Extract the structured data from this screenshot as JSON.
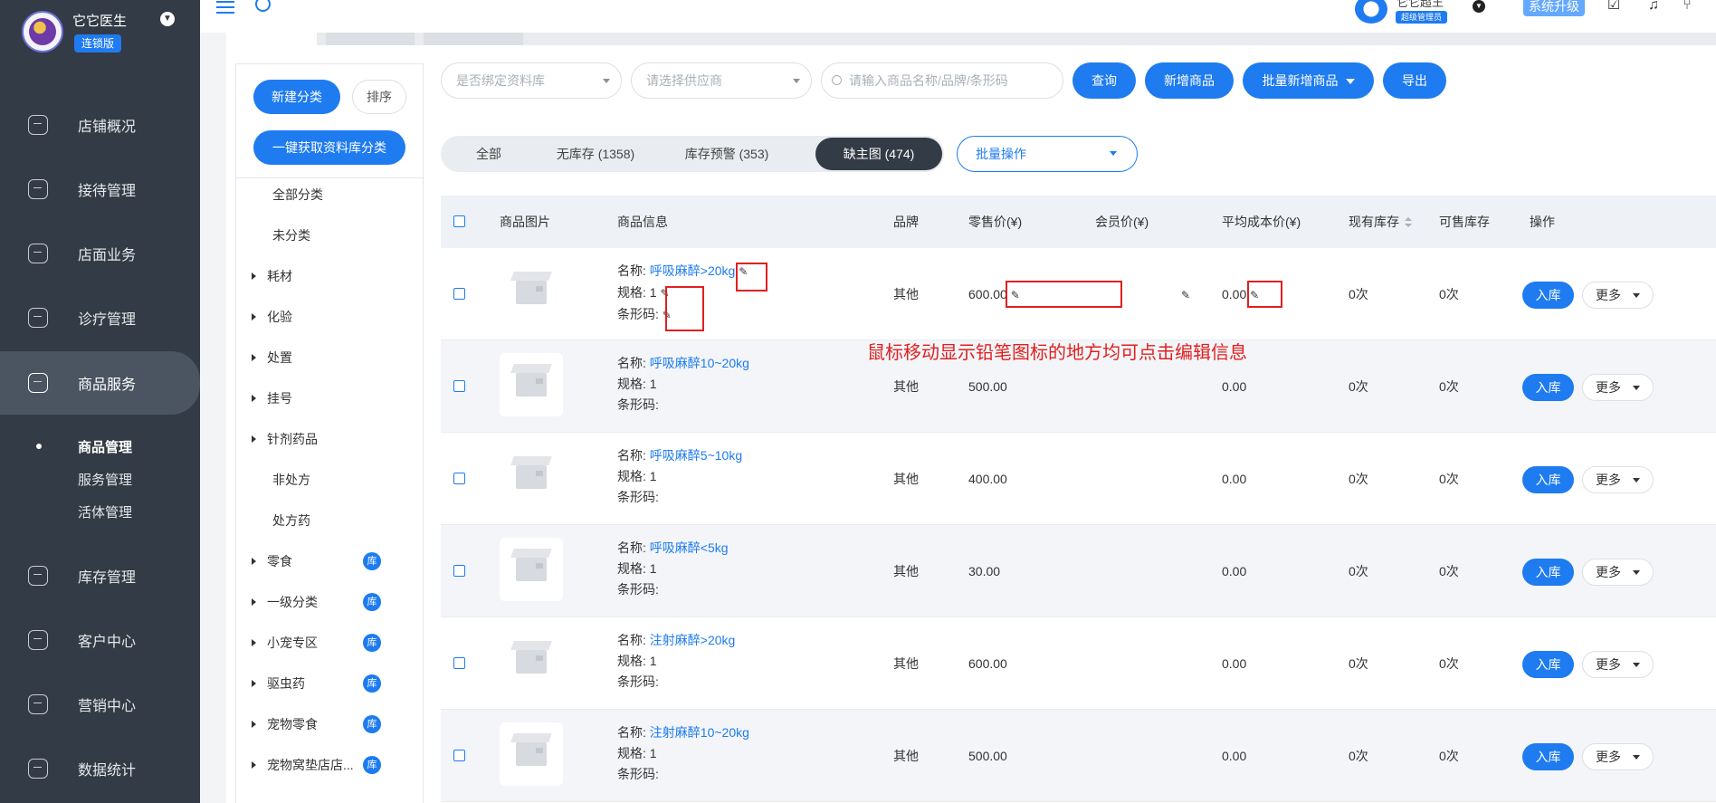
{
  "brand": {
    "name": "它它医生",
    "badge": "连锁版"
  },
  "header": {
    "user_name": "它它超王",
    "user_role": "超级管理员",
    "upgrade_label": "系统升级"
  },
  "sidebar": {
    "items": [
      {
        "label": "店铺概况"
      },
      {
        "label": "接待管理"
      },
      {
        "label": "店面业务"
      },
      {
        "label": "诊疗管理"
      },
      {
        "label": "商品服务"
      },
      {
        "label": "库存管理"
      },
      {
        "label": "客户中心"
      },
      {
        "label": "营销中心"
      },
      {
        "label": "数据统计"
      }
    ],
    "subitems": [
      {
        "label": "商品管理"
      },
      {
        "label": "服务管理"
      },
      {
        "label": "活体管理"
      }
    ]
  },
  "categories": {
    "new_label": "新建分类",
    "sort_label": "排序",
    "fetch_label": "一键获取资料库分类",
    "badge": "库",
    "items": [
      {
        "label": "全部分类"
      },
      {
        "label": "未分类"
      },
      {
        "label": "耗材"
      },
      {
        "label": "化验"
      },
      {
        "label": "处置"
      },
      {
        "label": "挂号"
      },
      {
        "label": "针剂药品"
      },
      {
        "label": "非处方"
      },
      {
        "label": "处方药"
      },
      {
        "label": "零食"
      },
      {
        "label": "一级分类"
      },
      {
        "label": "小宠专区"
      },
      {
        "label": "驱虫药"
      },
      {
        "label": "宠物零食"
      },
      {
        "label": "宠物窝垫店店..."
      }
    ]
  },
  "filters": {
    "library_placeholder": "是否绑定资料库",
    "supplier_placeholder": "请选择供应商",
    "search_placeholder": "请输入商品名称/品牌/条形码",
    "query_label": "查询",
    "add_label": "新增商品",
    "batch_add_label": "批量新增商品",
    "export_label": "导出"
  },
  "status_tabs": [
    {
      "label": "全部"
    },
    {
      "label": "无库存 (1358)"
    },
    {
      "label": "库存预警 (353)"
    },
    {
      "label": "缺主图 (474)"
    }
  ],
  "batch_ops_label": "批量操作",
  "table": {
    "headers": {
      "image": "商品图片",
      "info": "商品信息",
      "brand": "品牌",
      "retail": "零售价(¥)",
      "member": "会员价(¥)",
      "avg_cost": "平均成本价(¥)",
      "stock": "现有库存",
      "sellable": "可售库存",
      "actions": "操作"
    },
    "labels": {
      "name": "名称:",
      "spec": "规格:",
      "barcode": "条形码:"
    },
    "in_label": "入库",
    "more_label": "更多",
    "rows": [
      {
        "name": "呼吸麻醉>20kg",
        "spec": "1",
        "brand": "其他",
        "retail": "600.00",
        "avg_cost": "0.00",
        "stock": "0次",
        "sellable": "0次"
      },
      {
        "name": "呼吸麻醉10~20kg",
        "spec": "1",
        "brand": "其他",
        "retail": "500.00",
        "avg_cost": "0.00",
        "stock": "0次",
        "sellable": "0次"
      },
      {
        "name": "呼吸麻醉5~10kg",
        "spec": "1",
        "brand": "其他",
        "retail": "400.00",
        "avg_cost": "0.00",
        "stock": "0次",
        "sellable": "0次"
      },
      {
        "name": "呼吸麻醉<5kg",
        "spec": "1",
        "brand": "其他",
        "retail": "30.00",
        "avg_cost": "0.00",
        "stock": "0次",
        "sellable": "0次"
      },
      {
        "name": "注射麻醉>20kg",
        "spec": "1",
        "brand": "其他",
        "retail": "600.00",
        "avg_cost": "0.00",
        "stock": "0次",
        "sellable": "0次"
      },
      {
        "name": "注射麻醉10~20kg",
        "spec": "1",
        "brand": "其他",
        "retail": "500.00",
        "avg_cost": "0.00",
        "stock": "0次",
        "sellable": "0次"
      }
    ]
  },
  "annotation": "鼠标移动显示铅笔图标的地方均可点击编辑信息"
}
